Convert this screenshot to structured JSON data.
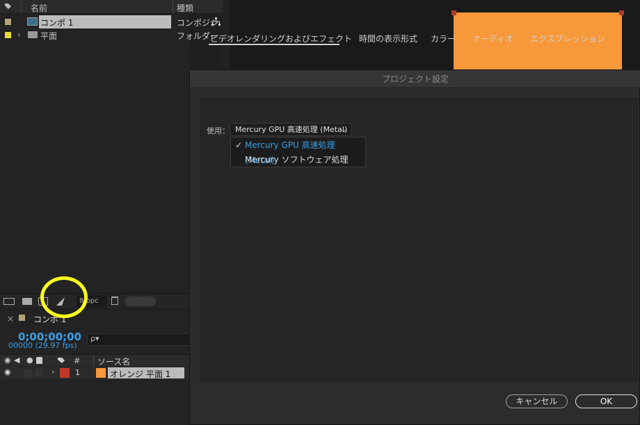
{
  "project": {
    "col_name": "名前",
    "col_type": "種類",
    "items": [
      {
        "name": "コンポ 1",
        "type": "コンポジシ",
        "color": "#b6a27c"
      },
      {
        "name": "平面",
        "type": "フォルダー",
        "color": "#e8d93a"
      }
    ],
    "bpc": "8 bpc"
  },
  "timeline": {
    "close": "×",
    "comp_name": "コンポ 1",
    "timecode": "0;00;00;00",
    "fps": "00000 (29.97 fps)",
    "search_icon_label": "ρ▾",
    "col_hash": "#",
    "col_source": "ソース名",
    "layers": [
      {
        "index": "1",
        "name": "オレンジ 平面 1",
        "label_color": "#c0392b",
        "layer_color": "#f7993a"
      }
    ]
  },
  "dialog": {
    "title": "プロジェクト設定",
    "tabs": [
      "ビデオレンダリングおよびエフェクト",
      "時間の表示形式",
      "カラー",
      "オーディオ",
      "エクスプレッション"
    ],
    "use_label": "使用：",
    "dropdown_value": "Mercury GPU 高速処理 (Metal)",
    "menu_items": [
      {
        "label": "Mercury GPU 高速処理 (Metal)",
        "checked": true
      },
      {
        "label": "Mercury ソフトウェア処理",
        "checked": false
      }
    ],
    "cancel": "キャンセル",
    "ok": "OK"
  },
  "colors": {
    "accent_blue": "#3b9ee6",
    "orange": "#f7993a",
    "highlight": "#ffff20"
  }
}
